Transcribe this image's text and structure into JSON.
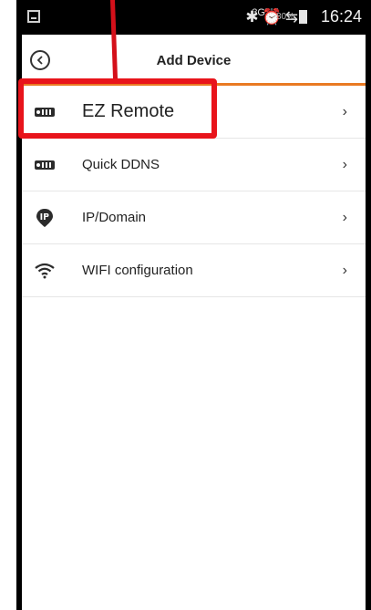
{
  "status_bar": {
    "network": "3G",
    "battery_percent": "80%",
    "time": "16:24"
  },
  "header": {
    "title": "Add Device",
    "accent_color": "#e97a23"
  },
  "list": [
    {
      "label": "EZ Remote",
      "icon": "remote-device-icon"
    },
    {
      "label": "Quick DDNS",
      "icon": "remote-device-icon"
    },
    {
      "label": "IP/Domain",
      "icon": "ip-pin-icon"
    },
    {
      "label": "WIFI configuration",
      "icon": "wifi-icon"
    }
  ],
  "annotation": {
    "highlight_color": "#e8141b"
  }
}
